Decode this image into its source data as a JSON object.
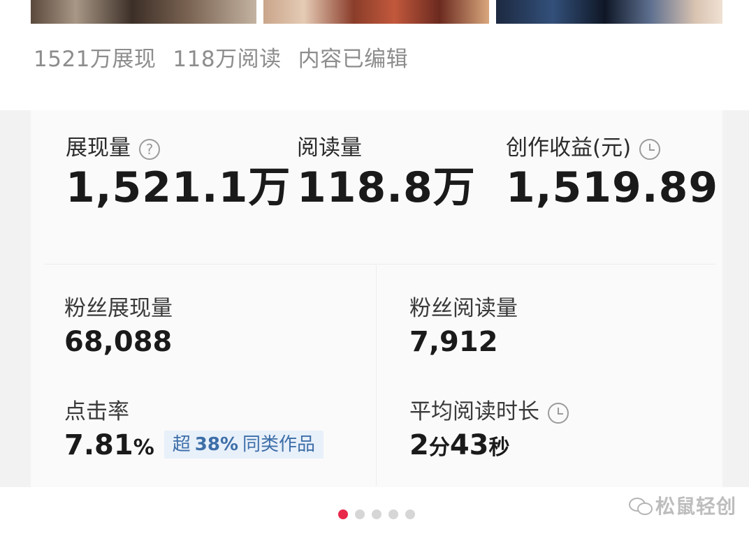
{
  "summary": {
    "impressions": "1521万展现",
    "reads": "118万阅读",
    "edited": "内容已编辑"
  },
  "metrics": {
    "impressions": {
      "label": "展现量",
      "value": "1,521.1万",
      "icon": "help-icon"
    },
    "reads": {
      "label": "阅读量",
      "value": "118.8万"
    },
    "revenue": {
      "label": "创作收益(元)",
      "value": "1,519.89",
      "icon": "clock-icon"
    }
  },
  "details": {
    "fan_impressions": {
      "label": "粉丝展现量",
      "value": "68,088"
    },
    "fan_reads": {
      "label": "粉丝阅读量",
      "value": "7,912"
    },
    "ctr": {
      "label": "点击率",
      "value": "7.81",
      "unit": "%",
      "badge": {
        "prefix": "超",
        "percent": "38%",
        "suffix": "同类作品"
      }
    },
    "avg_read_time": {
      "label": "平均阅读时长",
      "icon": "clock-icon",
      "minutes": "2",
      "minutes_unit": "分",
      "seconds": "43",
      "seconds_unit": "秒"
    }
  },
  "pager": {
    "total": 5,
    "active": 1
  },
  "watermark": {
    "text": "松鼠轻创",
    "icon": "wechat-icon"
  },
  "colors": {
    "accent": "#e8294a",
    "badge_text": "#3d6ea8",
    "badge_bg": "#e8f0fa"
  }
}
